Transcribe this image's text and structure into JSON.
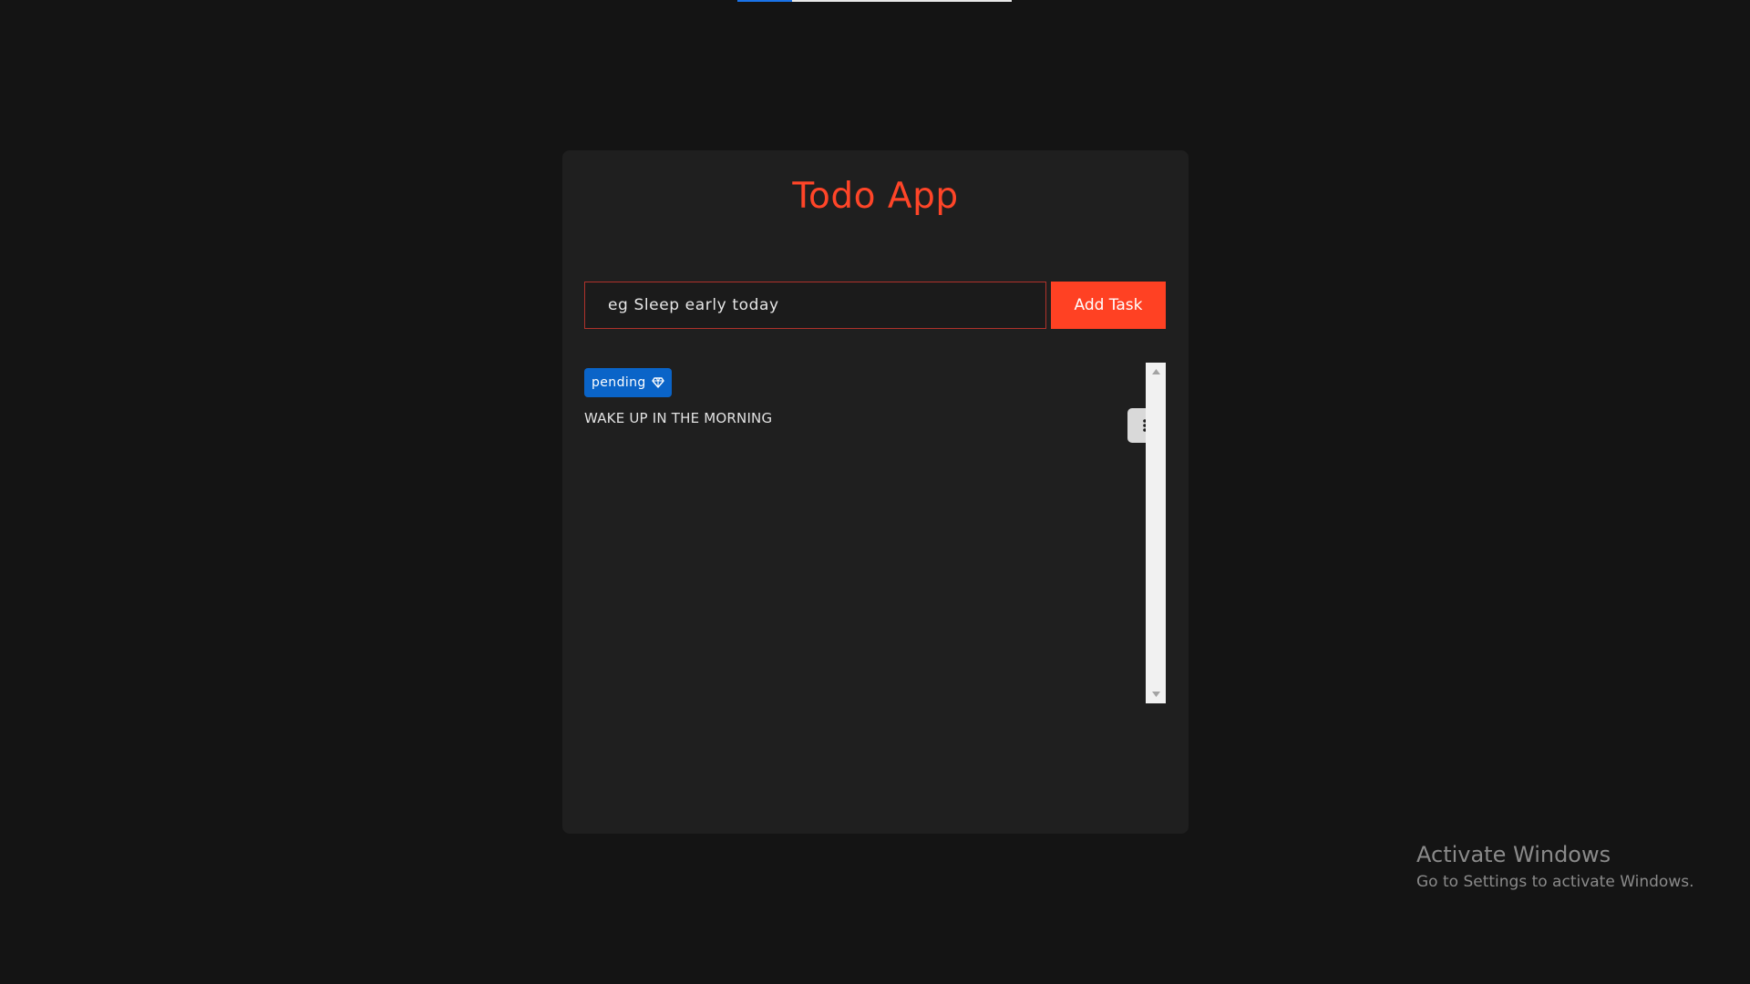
{
  "page_progress": {
    "fraction": 0.2
  },
  "app": {
    "title": "Todo App",
    "accent_color": "#ff4528"
  },
  "task_form": {
    "input_placeholder": "eg Sleep early today",
    "input_value": "",
    "add_button_label": "Add Task"
  },
  "tasks": [
    {
      "status": "pending",
      "status_icon": "gem-icon",
      "status_color": "#0a64c8",
      "text": "WAKE UP IN THE MORNING",
      "menu_icon": "more-vertical-icon"
    }
  ],
  "windows_watermark": {
    "title": "Activate Windows",
    "subtitle": "Go to Settings to activate Windows."
  }
}
